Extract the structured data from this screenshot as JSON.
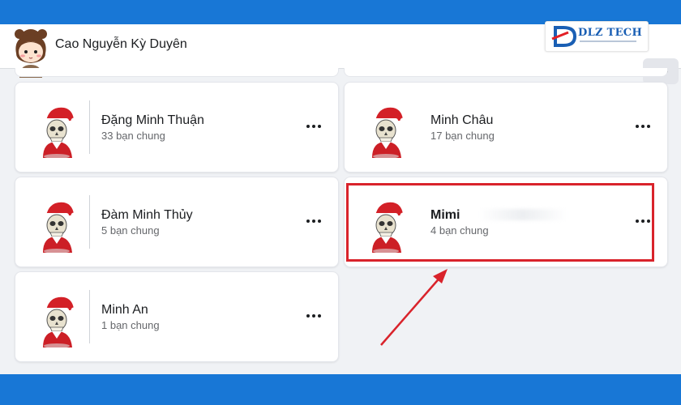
{
  "header": {
    "profile_name": "Cao Nguyễn Kỳ Duyên",
    "brand_name": "DLZ TECH"
  },
  "friends": [
    {
      "name": "Đặng Minh Thuận",
      "mutual": "33 bạn chung"
    },
    {
      "name": "Minh Châu",
      "mutual": "17 bạn chung"
    },
    {
      "name": "Đàm Minh Thủy",
      "mutual": "5 bạn chung"
    },
    {
      "name": "Mimi",
      "mutual": "4 bạn chung"
    },
    {
      "name": "Minh An",
      "mutual": "1 bạn chung"
    }
  ],
  "colors": {
    "facebook_blue": "#1877d6",
    "highlight_red": "#d9232b",
    "background": "#f0f2f5"
  },
  "icons": {
    "more": "more-horizontal-icon",
    "avatar": "santa-skull-avatar-icon"
  }
}
